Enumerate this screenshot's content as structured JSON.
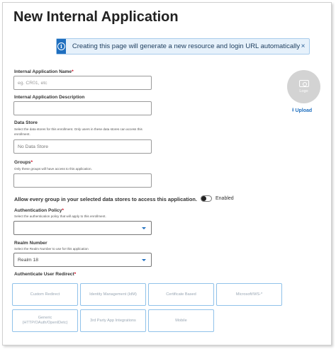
{
  "page": {
    "title": "New Internal Application"
  },
  "banner": {
    "icon": "info-icon",
    "message": "Creating this page will generate a new resource and login URL automatically",
    "close": "×"
  },
  "form": {
    "app_name": {
      "label": "Internal Application Name",
      "required": "*",
      "placeholder": "eg. CR01, etc"
    },
    "description": {
      "label": "Internal Application Description",
      "value": ""
    },
    "data_store": {
      "label": "Data Store",
      "help": "Select the data stores for this enrollment. Only users in these data stores can access this enrollment.",
      "value": "No Data Store"
    },
    "groups": {
      "label": "Groups",
      "required": "*",
      "help": "Only these groups will have access to this application.",
      "value": ""
    },
    "allow_group": {
      "label": "Allow every group in your selected data stores to access this application.",
      "toggle_label": "Enabled"
    },
    "auth_policy": {
      "label": "Authentication Policy",
      "required": "*",
      "help": "Select the authentication policy that will apply to this enrollment.",
      "value": ""
    },
    "realm": {
      "label": "Realm Number",
      "help": "Select the Realm Number to use for this application",
      "value": "Realm 18"
    },
    "redirect": {
      "label": "Authenticate User Redirect",
      "required": "*",
      "options": [
        {
          "label": "Custom Redirect"
        },
        {
          "label": "Identity Management (IdM)"
        },
        {
          "label": "Certificate Based"
        },
        {
          "label": "Microsoft/WS-*"
        },
        {
          "label": "Generic (HTTP/OAuth/OpenIDetc)"
        },
        {
          "label": "3rd Party App Integrations"
        },
        {
          "label": "Mobile"
        }
      ]
    }
  },
  "logo": {
    "text": "Logo",
    "upload_label": "Upload",
    "icon": "image-icon"
  },
  "colors": {
    "accent": "#1f6fbf",
    "banner_bg": "#e6f1fb",
    "tile_border": "#90c2ea",
    "required": "#d0021b"
  }
}
